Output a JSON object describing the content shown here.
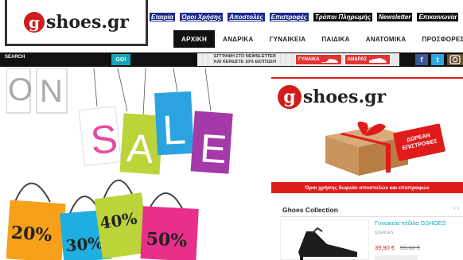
{
  "brand": {
    "logo_text": "shoes.gr",
    "logo_letter": "g"
  },
  "top_links": [
    "Εταιρία",
    "Όροι Χρήσης",
    "Αποστολές",
    "Επιστροφές",
    "Τρόποι Πληρωμής",
    "Newsletter",
    "Επικοινωνία"
  ],
  "nav": [
    "ΑΡΧΙΚΗ",
    "ΑΝΔΡΙΚΑ",
    "ΓΥΝΑΙΚΕΙΑ",
    "ΠΑΙΔΙΚΑ",
    "ΑΝΑΤΟΜΙΚΑ",
    "ΠΡΟΣΦΟΡΕΣ"
  ],
  "search": {
    "label": "SEARCH",
    "button": "GO!"
  },
  "promo": {
    "newsletter_line1": "ΕΓΓΡΑΦΗ ΣΤΟ NEWSLETTER",
    "newsletter_line2": "ΚΑΙ ΚΕΡΔΙΣΤΕ 10% ΕΚΠΤΩΣΗ",
    "women": "ΓΥΝΑΙΚΑ",
    "men": "ΑΝΔΡΑΣ"
  },
  "social": [
    "f",
    "t"
  ],
  "sale": {
    "letters": [
      "O",
      "N",
      "S",
      "A",
      "L",
      "E"
    ],
    "discounts": [
      "20%",
      "30%",
      "40%",
      "50%"
    ]
  },
  "ad": {
    "logo_text": "shoes.gr",
    "logo_letter": "g",
    "badge_line1": "ΔΩΡΕΑΝ",
    "badge_line2": "ΕΠΙΣΤΡΟΦΕΣ",
    "footer": "Όροι χρήσης δωρεάν αποστολών και επιστροφών"
  },
  "collection": {
    "title": "Ghoes Collection",
    "product_name": "Γυναικεία πέδιλα GSHOES",
    "product_brand": "GSHOES",
    "price": "39,90 €",
    "old_price": "55,00 €"
  },
  "colors": {
    "brand_red": "#d21c1c",
    "accent_teal": "#16a4b8",
    "facebook": "#3b5998",
    "twitter": "#2aa9e0"
  }
}
